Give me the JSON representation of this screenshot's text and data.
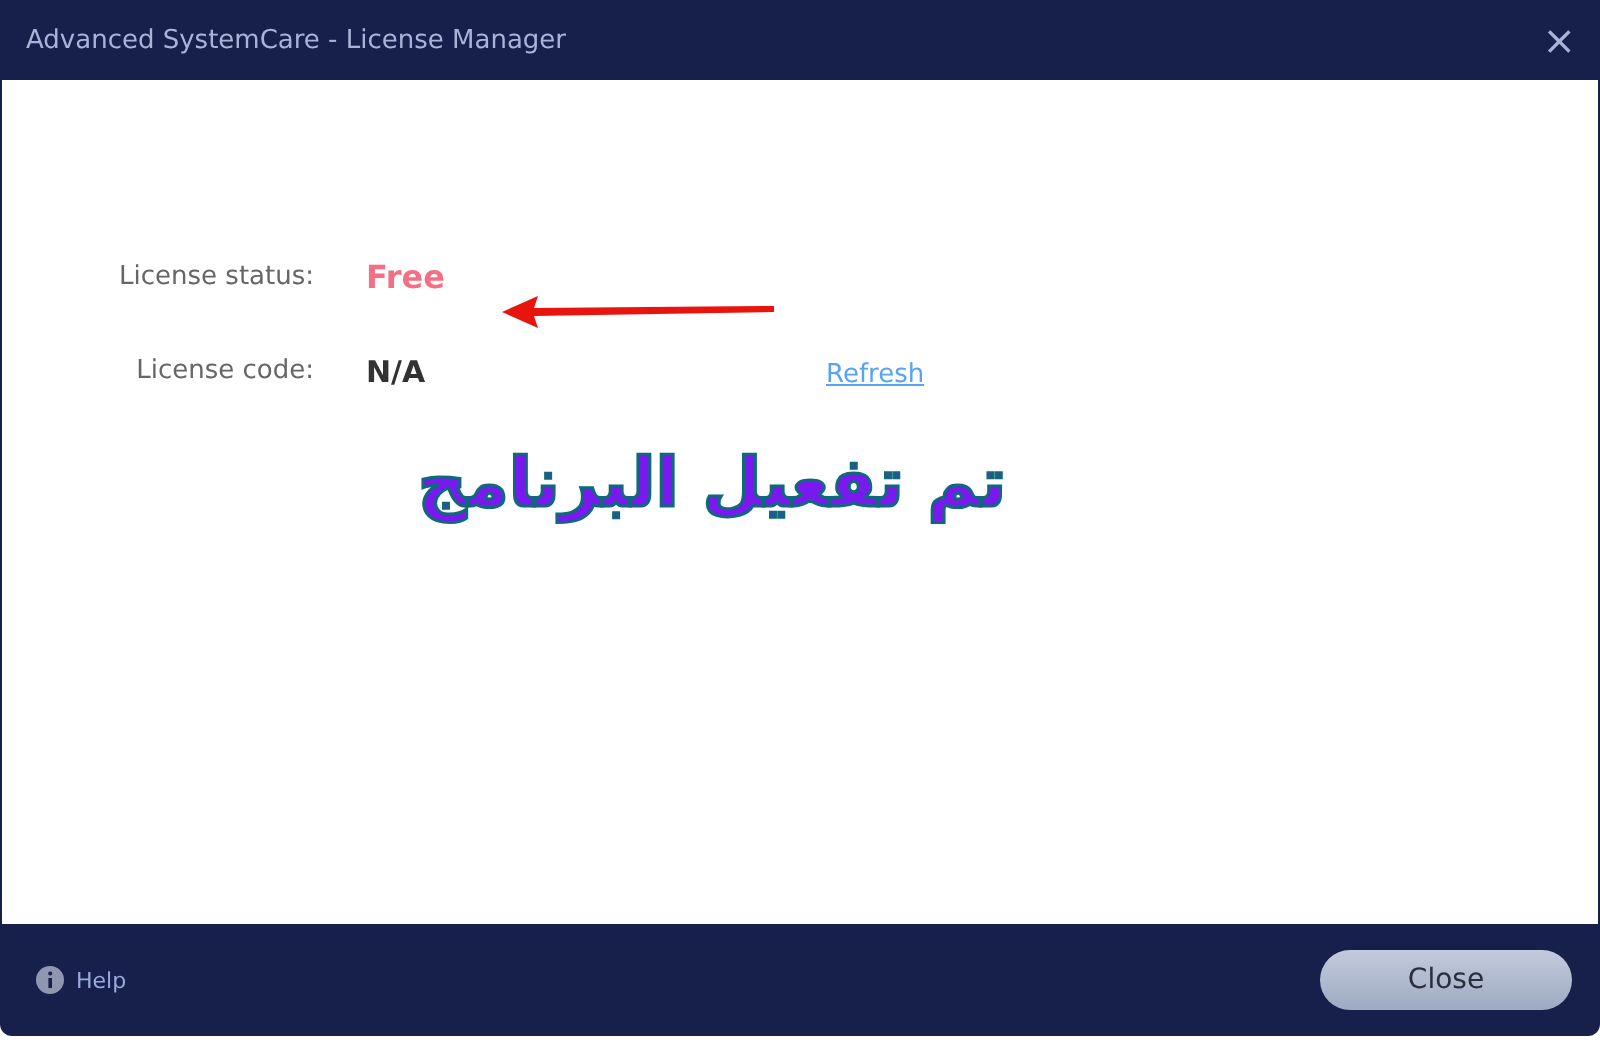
{
  "window": {
    "title": "Advanced SystemCare - License Manager",
    "close": "×"
  },
  "fields": [
    {
      "label": "License status:",
      "value": "Free",
      "kind": "status"
    },
    {
      "label": "License code:",
      "value": "N/A",
      "kind": "code",
      "link": "Refresh"
    }
  ],
  "annotation": {
    "text": "تم تفعيل البرنامج"
  },
  "footer": {
    "help": "Help",
    "close_button": "Close"
  }
}
